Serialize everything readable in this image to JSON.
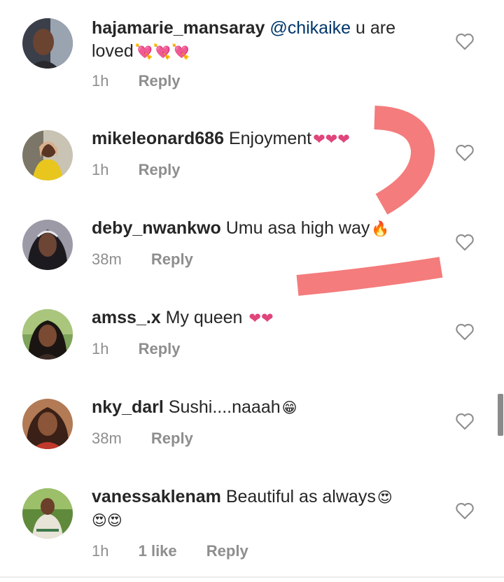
{
  "comments": [
    {
      "username": "hajamarie_mansaray",
      "mention": "@chikaike",
      "text": "u are loved",
      "emoji": "💘💘💘",
      "time": "1h",
      "reply": "Reply"
    },
    {
      "username": "mikeleonard686",
      "text": "Enjoyment",
      "emoji": "❤❤❤",
      "time": "1h",
      "reply": "Reply"
    },
    {
      "username": "deby_nwankwo",
      "text": "Umu asa high way",
      "emoji": "🔥",
      "time": "38m",
      "reply": "Reply"
    },
    {
      "username": "amss_.x",
      "text": "My queen",
      "emoji": "❤❤",
      "time": "1h",
      "reply": "Reply"
    },
    {
      "username": "nky_darl",
      "text": "Sushi....naaah",
      "emoji": "😁",
      "time": "38m",
      "reply": "Reply"
    },
    {
      "username": "vanessaklenam",
      "text": "Beautiful as always",
      "emoji": "😍",
      "emoji_line2": "😍😍",
      "time": "1h",
      "likes": "1 like",
      "reply": "Reply"
    }
  ],
  "icons": {
    "like": "heart-outline-icon"
  },
  "colors": {
    "username": "#262626",
    "mention": "#00376b",
    "meta": "#8e8e8e",
    "heart_emoji": "#e0457b",
    "doodle": "#f47c7c"
  }
}
